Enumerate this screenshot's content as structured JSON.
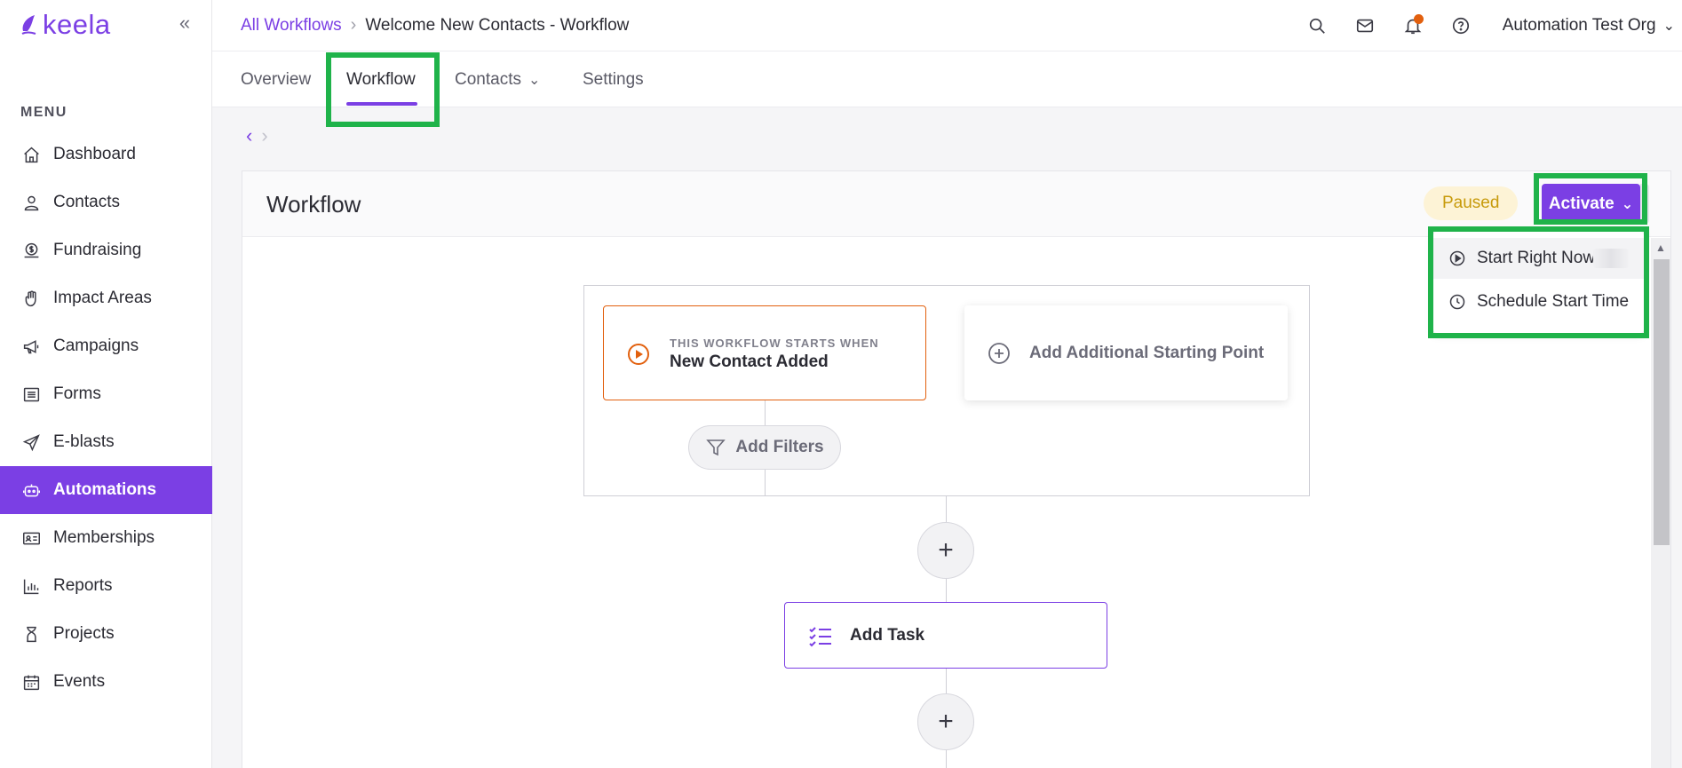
{
  "brand": {
    "name": "keela",
    "color": "#7b3fe4"
  },
  "sidebar": {
    "menu_label": "MENU",
    "items": [
      {
        "label": "Dashboard",
        "icon": "home-icon"
      },
      {
        "label": "Contacts",
        "icon": "user-icon"
      },
      {
        "label": "Fundraising",
        "icon": "dollar-icon"
      },
      {
        "label": "Impact Areas",
        "icon": "hand-icon"
      },
      {
        "label": "Campaigns",
        "icon": "megaphone-icon"
      },
      {
        "label": "Forms",
        "icon": "list-icon"
      },
      {
        "label": "E-blasts",
        "icon": "paper-plane-icon"
      },
      {
        "label": "Automations",
        "icon": "robot-icon",
        "active": true
      },
      {
        "label": "Memberships",
        "icon": "id-card-icon"
      },
      {
        "label": "Reports",
        "icon": "bar-chart-icon"
      },
      {
        "label": "Projects",
        "icon": "hourglass-icon"
      },
      {
        "label": "Events",
        "icon": "calendar-icon"
      }
    ]
  },
  "header": {
    "breadcrumb_link": "All Workflows",
    "breadcrumb_current": "Welcome New Contacts - Workflow",
    "org_name": "Automation Test Org",
    "notification_dot_color": "#e2600e"
  },
  "tabs": [
    {
      "label": "Overview"
    },
    {
      "label": "Workflow",
      "active": true
    },
    {
      "label": "Contacts",
      "has_dropdown": true
    },
    {
      "label": "Settings"
    }
  ],
  "panel": {
    "title": "Workflow",
    "status_badge": "Paused",
    "activate_label": "Activate",
    "dropdown": {
      "items": [
        {
          "label": "Start Right Now",
          "icon": "play-circle-icon"
        },
        {
          "label": "Schedule Start Time",
          "icon": "clock-icon"
        }
      ]
    }
  },
  "canvas": {
    "trigger_kicker": "THIS WORKFLOW STARTS WHEN",
    "trigger_name": "New Contact Added",
    "add_start_label": "Add Additional Starting Point",
    "add_filters_label": "Add Filters",
    "add_step_symbol": "+",
    "task_label": "Add Task"
  },
  "colors": {
    "accent": "#7b3fe4",
    "trigger_border": "#e2600e",
    "highlight": "#1fb34a",
    "paused_bg": "#fdf3d6",
    "paused_text": "#c79a0b"
  }
}
